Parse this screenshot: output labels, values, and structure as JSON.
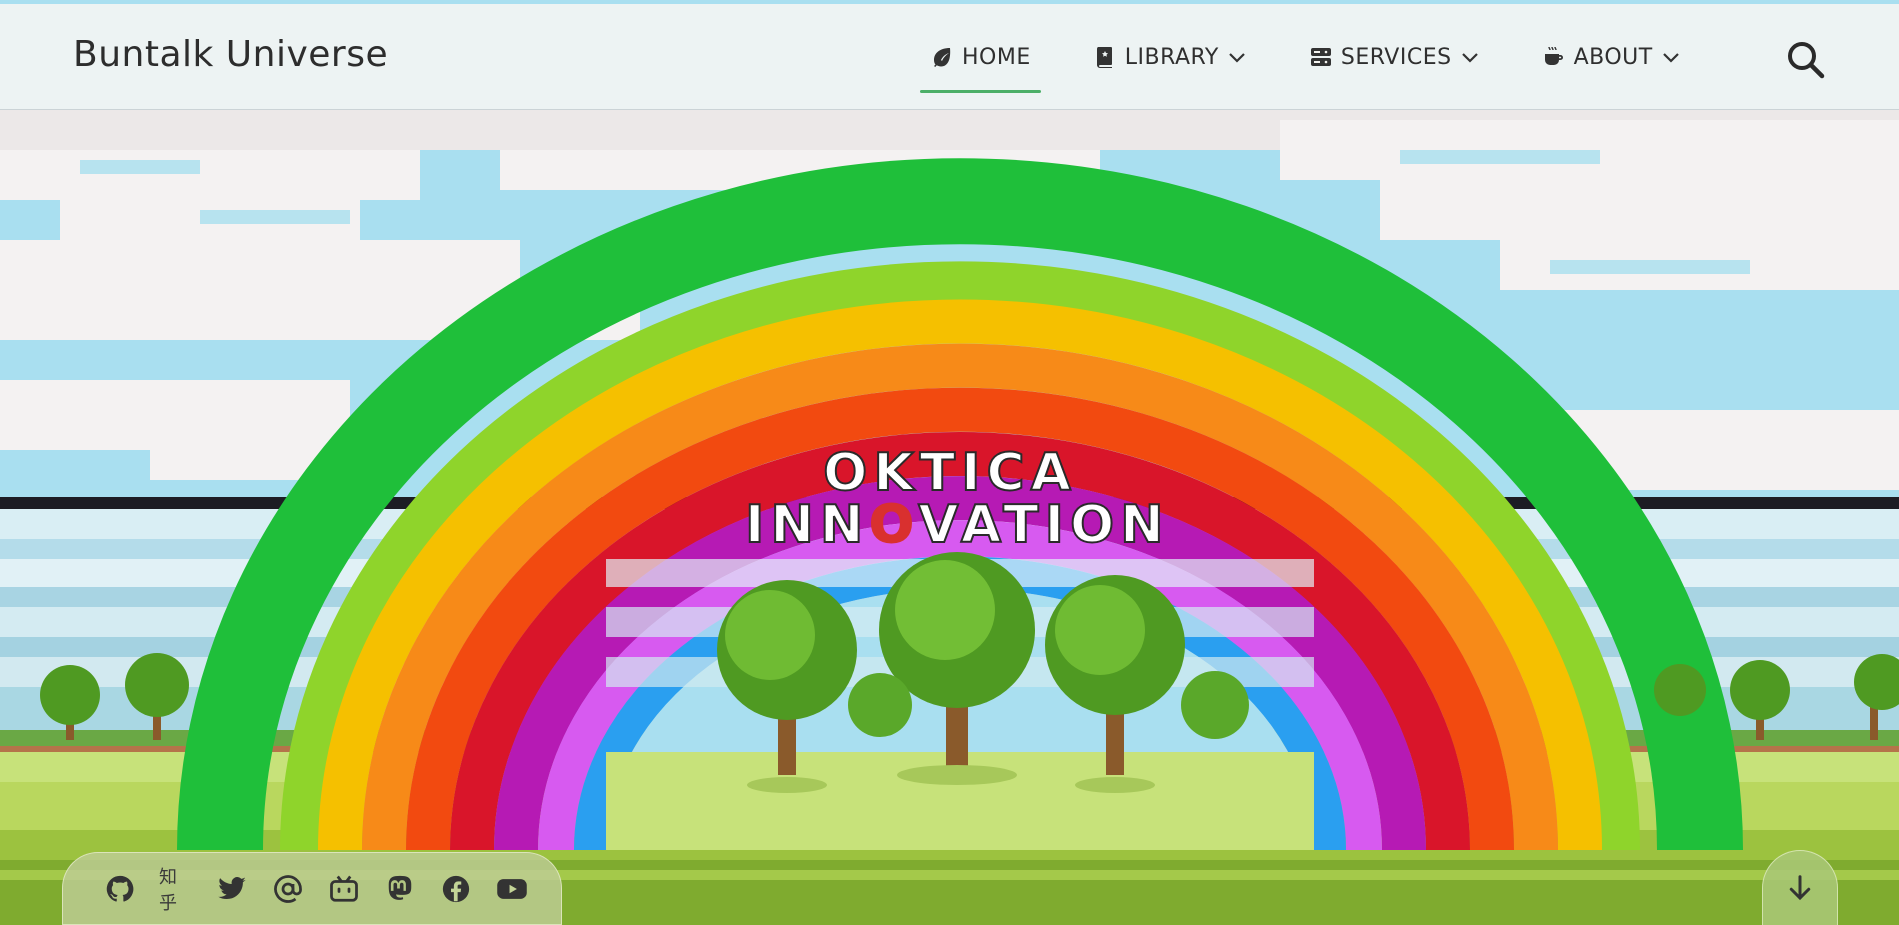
{
  "site": {
    "brand": "Buntalk Universe"
  },
  "nav": {
    "items": [
      {
        "label": "HOME",
        "icon": "leaf-icon",
        "active": true,
        "dropdown": false
      },
      {
        "label": "LIBRARY",
        "icon": "book-icon",
        "active": false,
        "dropdown": true
      },
      {
        "label": "SERVICES",
        "icon": "server-icon",
        "active": false,
        "dropdown": true
      },
      {
        "label": "ABOUT",
        "icon": "coffee-icon",
        "active": false,
        "dropdown": true
      }
    ],
    "search_icon": "search-icon",
    "active_color": "#4caf68"
  },
  "hero": {
    "logo_line1": "OKTICA",
    "logo_line2": "INNOVATION",
    "accent_color": "#d9302f"
  },
  "social": {
    "items": [
      "github-icon",
      "zhihu-icon",
      "twitter-icon",
      "at-icon",
      "bilibili-icon",
      "mastodon-icon",
      "facebook-icon",
      "youtube-icon"
    ],
    "zhihu_label": "知乎"
  },
  "scroll": {
    "icon": "arrow-down-icon"
  }
}
